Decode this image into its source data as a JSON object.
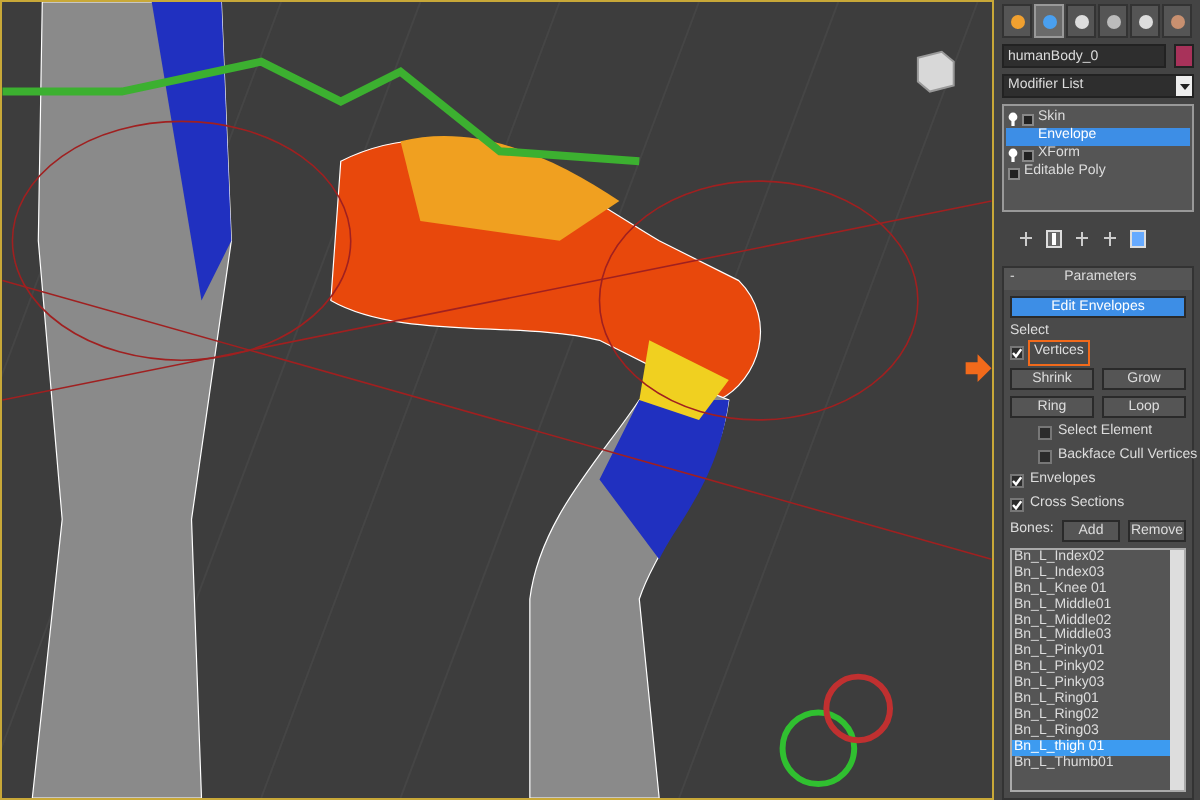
{
  "command_tabs": [
    {
      "kind": "create",
      "selected": false
    },
    {
      "kind": "modify",
      "selected": true
    },
    {
      "kind": "hierarchy",
      "selected": false
    },
    {
      "kind": "motion",
      "selected": false
    },
    {
      "kind": "display",
      "selected": false
    },
    {
      "kind": "utilities",
      "selected": false
    }
  ],
  "object_name": {
    "value": "humanBody_0",
    "color": "#a8325a"
  },
  "modifier_list": {
    "value": "Modifier List"
  },
  "modifier_stack": [
    {
      "label": "Skin",
      "kind": "modifier",
      "selected": false,
      "children": [
        {
          "label": "Envelope",
          "kind": "subobject",
          "selected": true
        }
      ]
    },
    {
      "label": "XForm",
      "kind": "modifier",
      "selected": false
    },
    {
      "label": "Editable Poly",
      "kind": "base",
      "selected": false
    }
  ],
  "parameters": {
    "title": "Parameters",
    "collapse": "-",
    "edit_envelopes": {
      "label": "Edit Envelopes",
      "selected": true
    },
    "select_label": "Select",
    "checks": [
      {
        "label": "Vertices",
        "checked": true,
        "highlighted": true,
        "indent": false
      }
    ],
    "buttons": [
      [
        "Shrink",
        "Grow"
      ],
      [
        "Ring",
        "Loop"
      ]
    ],
    "options": [
      {
        "label": "Select Element",
        "checked": false
      },
      {
        "label": "Backface Cull Vertices",
        "checked": false
      },
      {
        "label": "Envelopes",
        "checked": true
      },
      {
        "label": "Cross Sections",
        "checked": true
      }
    ],
    "bones_label": "Bones:",
    "add": "Add",
    "remove": "Remove"
  },
  "bones": [
    {
      "label": "Bn_L_Index02",
      "selected": false
    },
    {
      "label": "Bn_L_Index03",
      "selected": false
    },
    {
      "label": "Bn_L_Knee 01",
      "selected": false
    },
    {
      "label": "Bn_L_Middle01",
      "selected": false
    },
    {
      "label": "Bn_L_Middle02",
      "selected": false
    },
    {
      "label": "Bn_L_Middle03",
      "selected": false
    },
    {
      "label": "Bn_L_Pinky01",
      "selected": false
    },
    {
      "label": "Bn_L_Pinky02",
      "selected": false
    },
    {
      "label": "Bn_L_Pinky03",
      "selected": false
    },
    {
      "label": "Bn_L_Ring01",
      "selected": false
    },
    {
      "label": "Bn_L_Ring02",
      "selected": false
    },
    {
      "label": "Bn_L_Ring03",
      "selected": false
    },
    {
      "label": "Bn_L_thigh 01",
      "selected": true
    },
    {
      "label": "Bn_L_Thumb01",
      "selected": false
    }
  ]
}
